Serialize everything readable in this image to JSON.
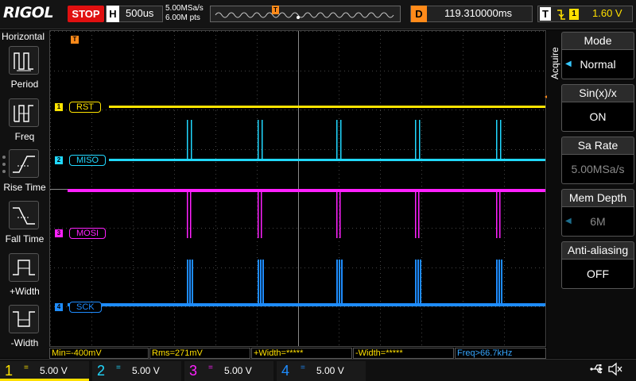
{
  "topbar": {
    "brand": "RIGOL",
    "run_state": "STOP",
    "horizontal_key": "H",
    "timebase": "500us",
    "sample_rate": "5.00MSa/s",
    "memory_points": "6.00M pts",
    "delay_key": "D",
    "delay_value": "119.310000ms",
    "trigger_key": "T",
    "trigger_edge_icon": "falling-edge-icon",
    "trigger_source": "1",
    "trigger_level": "1.60 V",
    "trigger_marker": "T"
  },
  "left_menu": {
    "title": "Horizontal",
    "items": [
      {
        "label": "Period",
        "icon": "period-icon"
      },
      {
        "label": "Freq",
        "icon": "freq-icon"
      },
      {
        "label": "Rise Time",
        "icon": "rise-time-icon"
      },
      {
        "label": "Fall Time",
        "icon": "fall-time-icon"
      },
      {
        "label": "+Width",
        "icon": "pos-width-icon"
      },
      {
        "label": "-Width",
        "icon": "neg-width-icon"
      }
    ]
  },
  "channels": [
    {
      "num": "1",
      "label": "RST",
      "color": "#ffe400",
      "coupling": "=",
      "scale": "5.00 V"
    },
    {
      "num": "2",
      "label": "MISO",
      "color": "#21d8ff",
      "coupling": "=",
      "scale": "5.00 V"
    },
    {
      "num": "3",
      "label": "MOSI",
      "color": "#ff21ff",
      "coupling": "=",
      "scale": "5.00 V"
    },
    {
      "num": "4",
      "label": "SCK",
      "color": "#1e8cff",
      "coupling": "=",
      "scale": "5.00 V"
    }
  ],
  "measurements": {
    "min": "Min=-400mV",
    "rms": "Rms=271mV",
    "pos_width": "+Width=*****",
    "neg_width": "-Width=*****",
    "freq": "Freq>66.7kHz"
  },
  "right_menu": {
    "title": "Acquire",
    "items": [
      {
        "label": "Mode",
        "value": "Normal",
        "enabled": true
      },
      {
        "label": "Sin(x)/x",
        "value": "ON",
        "enabled": true
      },
      {
        "label": "Sa Rate",
        "value": "5.00MSa/s",
        "enabled": false
      },
      {
        "label": "Mem Depth",
        "value": "6M",
        "enabled": false
      },
      {
        "label": "Anti-aliasing",
        "value": "OFF",
        "enabled": true
      }
    ]
  }
}
